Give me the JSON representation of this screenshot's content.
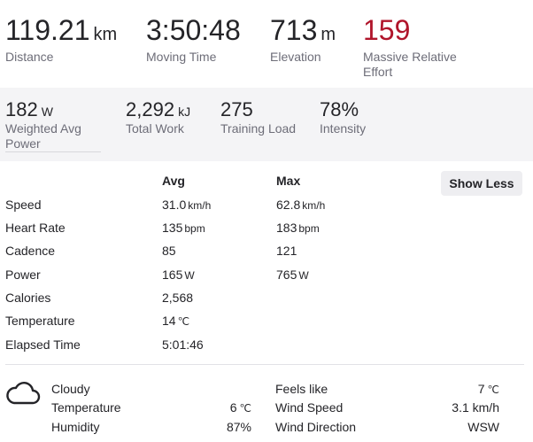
{
  "top_stats": [
    {
      "value": "119.21",
      "unit": "km",
      "label": "Distance"
    },
    {
      "value": "3:50:48",
      "unit": "",
      "label": "Moving Time"
    },
    {
      "value": "713",
      "unit": "m",
      "label": "Elevation"
    },
    {
      "value": "159",
      "unit": "",
      "label_line1": "Massive Relative",
      "label_line2": "Effort"
    }
  ],
  "power_stats": [
    {
      "value": "182",
      "unit": "W",
      "label_line1": "Weighted Avg",
      "label_line2": "Power"
    },
    {
      "value": "2,292",
      "unit": "kJ",
      "label": "Total Work"
    },
    {
      "value": "275",
      "unit": "",
      "label": "Training Load"
    },
    {
      "value": "78%",
      "unit": "",
      "label": "Intensity"
    }
  ],
  "table": {
    "avg_header": "Avg",
    "max_header": "Max",
    "show_less_label": "Show Less",
    "rows": [
      {
        "label": "Speed",
        "avg": "31.0",
        "avg_unit": "km/h",
        "max": "62.8",
        "max_unit": "km/h"
      },
      {
        "label": "Heart Rate",
        "avg": "135",
        "avg_unit": "bpm",
        "max": "183",
        "max_unit": "bpm"
      },
      {
        "label": "Cadence",
        "avg": "85",
        "avg_unit": "",
        "max": "121",
        "max_unit": ""
      },
      {
        "label": "Power",
        "avg": "165",
        "avg_unit": "W",
        "max": "765",
        "max_unit": "W"
      },
      {
        "label": "Calories",
        "avg": "2,568",
        "avg_unit": "",
        "max": "",
        "max_unit": ""
      },
      {
        "label": "Temperature",
        "avg": "14",
        "avg_unit": "℃",
        "max": "",
        "max_unit": ""
      },
      {
        "label": "Elapsed Time",
        "avg": "5:01:46",
        "avg_unit": "",
        "max": "",
        "max_unit": ""
      }
    ]
  },
  "weather": {
    "icon": "cloud-icon",
    "condition": "Cloudy",
    "left": [
      {
        "label": "Temperature",
        "value": "6",
        "unit": "℃"
      },
      {
        "label": "Humidity",
        "value": "87%",
        "unit": ""
      }
    ],
    "right": [
      {
        "label": "Feels like",
        "value": "7",
        "unit": "℃"
      },
      {
        "label": "Wind Speed",
        "value": "3.1 km/h",
        "unit": ""
      },
      {
        "label": "Wind Direction",
        "value": "WSW",
        "unit": ""
      }
    ]
  },
  "colors": {
    "accent_red": "#b0152b",
    "band": "#f4f4f6",
    "muted": "#6d6d78"
  }
}
